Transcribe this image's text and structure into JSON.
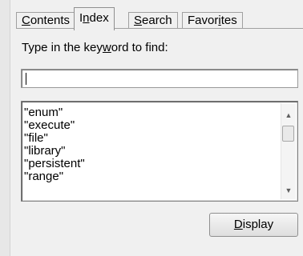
{
  "tabs": [
    {
      "pre": "",
      "key": "C",
      "post": "ontents",
      "active": false
    },
    {
      "pre": "I",
      "key": "n",
      "post": "dex",
      "active": true
    },
    {
      "pre": "",
      "key": "S",
      "post": "earch",
      "active": false
    },
    {
      "pre": "Favor",
      "key": "i",
      "post": "tes",
      "active": false
    }
  ],
  "prompt": {
    "pre": "Type in the key",
    "key": "w",
    "post": "ord to find:"
  },
  "keyword_input": {
    "value": ""
  },
  "list_items": [
    "\"enum\"",
    "\"execute\"",
    "\"file\"",
    "\"library\"",
    "\"persistent\"",
    "\"range\""
  ],
  "display_button": {
    "pre": "",
    "key": "D",
    "post": "isplay"
  },
  "icons": {
    "scroll_up": "▲",
    "scroll_down": "▼"
  }
}
